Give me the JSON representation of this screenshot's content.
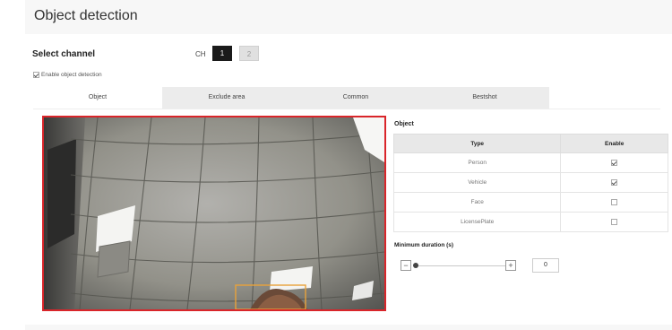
{
  "header": {
    "title": "Object detection"
  },
  "channel": {
    "label": "Select channel",
    "prefix": "CH",
    "options": [
      {
        "label": "1",
        "active": true
      },
      {
        "label": "2",
        "active": false
      }
    ]
  },
  "enable_detection": {
    "label": "Enable object detection",
    "checked": true
  },
  "tabs": [
    {
      "label": "Object",
      "active": true
    },
    {
      "label": "Exclude area",
      "active": false
    },
    {
      "label": "Common",
      "active": false
    },
    {
      "label": "Bestshot",
      "active": false
    }
  ],
  "object_panel": {
    "title": "Object",
    "columns": [
      "Type",
      "Enable"
    ],
    "rows": [
      {
        "type": "Person",
        "enabled": true
      },
      {
        "type": "Vehicle",
        "enabled": true
      },
      {
        "type": "Face",
        "enabled": false
      },
      {
        "type": "LicensePlate",
        "enabled": false
      }
    ]
  },
  "minimum_duration": {
    "label": "Minimum duration (s)",
    "value": "0",
    "decrease_symbol": "−",
    "increase_symbol": "+"
  },
  "colors": {
    "video_border": "#d9252a",
    "detection_box": "#e9a23a",
    "active_channel": "#1a1a1a"
  }
}
